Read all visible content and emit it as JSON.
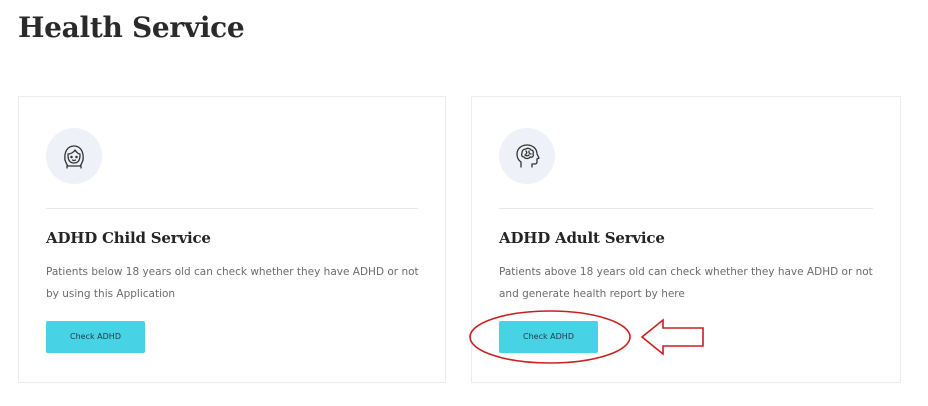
{
  "page": {
    "title": "Health Service"
  },
  "services": [
    {
      "icon": "child-face-icon",
      "title": "ADHD Child Service",
      "description": "Patients below 18 years old can check whether they have ADHD or not by using this Application",
      "button_label": "Check ADHD"
    },
    {
      "icon": "adult-brain-head-icon",
      "title": "ADHD Adult Service",
      "description": "Patients above 18 years old can check whether they have ADHD or not and generate health report by here",
      "button_label": "Check ADHD"
    }
  ],
  "annotation": {
    "shapes": [
      "highlight-ellipse",
      "pointer-arrow"
    ],
    "color": "#c8201e"
  },
  "colors": {
    "button_bg": "#47d3e5",
    "icon_circle_bg": "#eef1f7"
  }
}
